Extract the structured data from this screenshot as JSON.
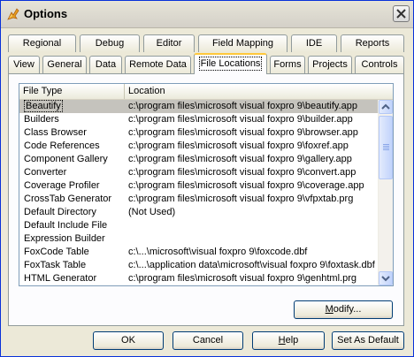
{
  "window": {
    "title": "Options"
  },
  "tabs_back": [
    {
      "label": "Regional"
    },
    {
      "label": "Debug"
    },
    {
      "label": "Editor"
    },
    {
      "label": "Field Mapping"
    },
    {
      "label": "IDE"
    },
    {
      "label": "Reports"
    }
  ],
  "tabs_front": [
    {
      "label": "View"
    },
    {
      "label": "General"
    },
    {
      "label": "Data"
    },
    {
      "label": "Remote Data"
    },
    {
      "label": "File Locations"
    },
    {
      "label": "Forms"
    },
    {
      "label": "Projects"
    },
    {
      "label": "Controls"
    }
  ],
  "active_tab": "File Locations",
  "list": {
    "columns": [
      "File Type",
      "Location"
    ],
    "rows": [
      {
        "type": "Beautify",
        "location": "c:\\program files\\microsoft visual foxpro 9\\beautify.app"
      },
      {
        "type": "Builders",
        "location": "c:\\program files\\microsoft visual foxpro 9\\builder.app"
      },
      {
        "type": "Class Browser",
        "location": "c:\\program files\\microsoft visual foxpro 9\\browser.app"
      },
      {
        "type": "Code References",
        "location": "c:\\program files\\microsoft visual foxpro 9\\foxref.app"
      },
      {
        "type": "Component Gallery",
        "location": "c:\\program files\\microsoft visual foxpro 9\\gallery.app"
      },
      {
        "type": "Converter",
        "location": "c:\\program files\\microsoft visual foxpro 9\\convert.app"
      },
      {
        "type": "Coverage Profiler",
        "location": "c:\\program files\\microsoft visual foxpro 9\\coverage.app"
      },
      {
        "type": "CrossTab Generator",
        "location": "c:\\program files\\microsoft visual foxpro 9\\vfpxtab.prg"
      },
      {
        "type": "Default Directory",
        "location": "(Not Used)"
      },
      {
        "type": "Default Include File",
        "location": ""
      },
      {
        "type": "Expression Builder",
        "location": ""
      },
      {
        "type": "FoxCode Table",
        "location": "c:\\...\\microsoft\\visual foxpro 9\\foxcode.dbf"
      },
      {
        "type": "FoxTask Table",
        "location": "c:\\...\\application data\\microsoft\\visual foxpro 9\\foxtask.dbf"
      },
      {
        "type": "HTML Generator",
        "location": "c:\\program files\\microsoft visual foxpro 9\\genhtml.prg"
      }
    ],
    "selected_index": 0
  },
  "buttons": {
    "modify": {
      "pre": "",
      "ul": "M",
      "post": "odify..."
    },
    "ok": "OK",
    "cancel": "Cancel",
    "help": {
      "pre": "",
      "ul": "H",
      "post": "elp"
    },
    "set_default": "Set As Default"
  },
  "colors": {
    "title_bar_border": "#0831d9",
    "selected_row": "#c5c3bd",
    "active_tab_accent": "#ffc83c"
  }
}
